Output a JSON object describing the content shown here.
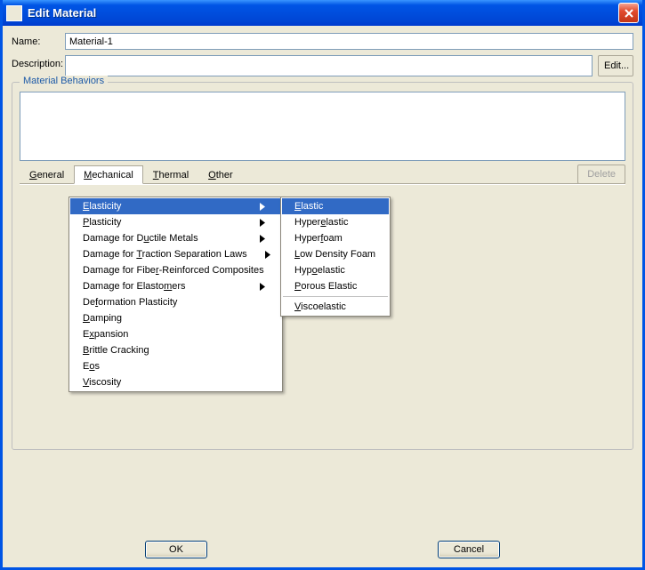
{
  "window": {
    "title": "Edit Material"
  },
  "labels": {
    "name": "Name:",
    "description": "Description:",
    "edit": "Edit...",
    "material_behaviors": "Material Behaviors",
    "delete": "Delete",
    "ok": "OK",
    "cancel": "Cancel"
  },
  "fields": {
    "name_value": "Material-1",
    "description_value": ""
  },
  "menubar": {
    "items": [
      {
        "label": "General",
        "mn": "G",
        "rest": "eneral"
      },
      {
        "label": "Mechanical",
        "mn": "M",
        "rest": "echanical",
        "open": true
      },
      {
        "label": "Thermal",
        "mn": "T",
        "rest": "hermal"
      },
      {
        "label": "Other",
        "mn": "O",
        "rest": "ther"
      }
    ]
  },
  "menu_mechanical": [
    {
      "pre": "",
      "mn": "E",
      "post": "lasticity",
      "submenu": true,
      "hl": true
    },
    {
      "pre": "",
      "mn": "P",
      "post": "lasticity",
      "submenu": true
    },
    {
      "pre": "Damage for D",
      "mn": "u",
      "post": "ctile Metals",
      "submenu": true
    },
    {
      "pre": "Damage for ",
      "mn": "T",
      "post": "raction Separation Laws",
      "submenu": true
    },
    {
      "pre": "Damage for Fibe",
      "mn": "r",
      "post": "-Reinforced Composites",
      "submenu": true
    },
    {
      "pre": "Damage for Elasto",
      "mn": "m",
      "post": "ers",
      "submenu": true
    },
    {
      "pre": "De",
      "mn": "f",
      "post": "ormation Plasticity"
    },
    {
      "pre": "",
      "mn": "D",
      "post": "amping"
    },
    {
      "pre": "E",
      "mn": "x",
      "post": "pansion"
    },
    {
      "pre": "",
      "mn": "B",
      "post": "rittle Cracking"
    },
    {
      "pre": "E",
      "mn": "o",
      "post": "s"
    },
    {
      "pre": "",
      "mn": "V",
      "post": "iscosity"
    }
  ],
  "menu_elasticity": [
    {
      "pre": "",
      "mn": "E",
      "post": "lastic",
      "hl": true
    },
    {
      "pre": "Hyper",
      "mn": "e",
      "post": "lastic"
    },
    {
      "pre": "Hyper",
      "mn": "f",
      "post": "oam"
    },
    {
      "pre": "",
      "mn": "L",
      "post": "ow Density Foam"
    },
    {
      "pre": "Hyp",
      "mn": "o",
      "post": "elastic"
    },
    {
      "pre": "",
      "mn": "P",
      "post": "orous Elastic"
    },
    {
      "sep": true
    },
    {
      "pre": "",
      "mn": "V",
      "post": "iscoelastic"
    }
  ]
}
